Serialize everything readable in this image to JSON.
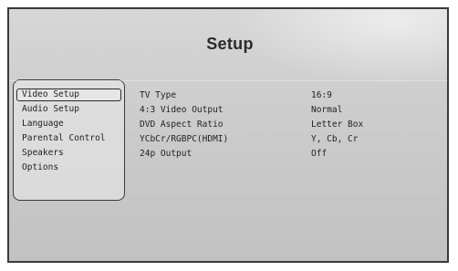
{
  "screen": {
    "title": "Setup"
  },
  "menu": {
    "items": [
      {
        "label": "Video Setup",
        "selected": true
      },
      {
        "label": "Audio Setup",
        "selected": false
      },
      {
        "label": "Language",
        "selected": false
      },
      {
        "label": "Parental Control",
        "selected": false
      },
      {
        "label": "Speakers",
        "selected": false
      },
      {
        "label": "Options",
        "selected": false
      }
    ]
  },
  "settings": [
    {
      "label": "TV Type",
      "value": "16:9"
    },
    {
      "label": "4:3 Video Output",
      "value": "Normal"
    },
    {
      "label": "DVD Aspect Ratio",
      "value": "Letter Box"
    },
    {
      "label": "YCbCr/RGBPC(HDMI)",
      "value": "Y, Cb, Cr"
    },
    {
      "label": "24p Output",
      "value": "Off"
    }
  ],
  "colors": {
    "background": "#cfcfcf",
    "frame": "#3a3a3a",
    "text": "#1f1f1f"
  }
}
